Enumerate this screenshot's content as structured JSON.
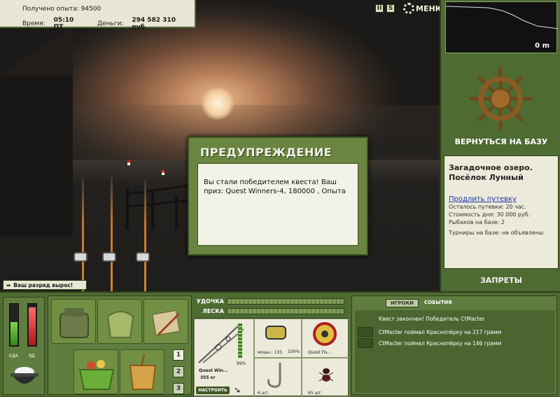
{
  "info": {
    "experience_label": "Получено опыта:",
    "experience_value": "94500",
    "time_label": "Время:",
    "time_value": "05:10 ПТ",
    "money_label": "Деньги:",
    "money_value": "294 582 310 руб."
  },
  "topbar": {
    "pause_icon": "II",
    "sound_icon": "S",
    "menu_label": "МЕНЮ"
  },
  "right": {
    "depth_value": "0 m",
    "return_label": "ВЕРНУТЬСЯ НА БАЗУ",
    "location_name": "Загадочное озеро. Посёлок Лунный",
    "extend_link": "Продлить путевку",
    "remaining": "Осталось путевки: 20 час.",
    "daily_cost": "Стоимость дня: 30 000 руб.",
    "fishers": "Рыбаков на базе: 2",
    "tournaments": "Турниры на базе: не объявлены",
    "bans_label": "ЗАПРЕТЫ"
  },
  "dialog": {
    "title": "ПРЕДУПРЕЖДЕНИЕ",
    "message": "Вы стали победителем квеста! Ваш приз: Quest Winners-4, 180000 , Опыта"
  },
  "rank_banner": "Ваш разряд вырос!",
  "food": {
    "food_label": "ЕДА",
    "drink_label": "ЯД",
    "food_level": 0.55,
    "drink_level": 0.9
  },
  "tabs": [
    "1",
    "2",
    "3"
  ],
  "tackle": {
    "rod_label": "УДОЧКА",
    "line_label": "ЛЕСКА",
    "rod_name": "Quest Win...",
    "rod_weight": "355 кг",
    "rod_pct": "99%",
    "configure_label": "НАСТРОИТЬ",
    "reel_power": "мощн.: 135",
    "reel_pct": "100%",
    "line_name": "Quest Fis...",
    "hook_count": "6 шт.",
    "bait_count": "65 шт."
  },
  "events": {
    "tab_players": "ИГРОКИ",
    "tab_events": "СОБЫТИЯ",
    "items": [
      "Квест закончен! Победитель CtMacter",
      "CtMacter поймал Краснопёрку на 217 грамм",
      "CtMacter поймал Краснопёрку на 146 грамм"
    ]
  }
}
